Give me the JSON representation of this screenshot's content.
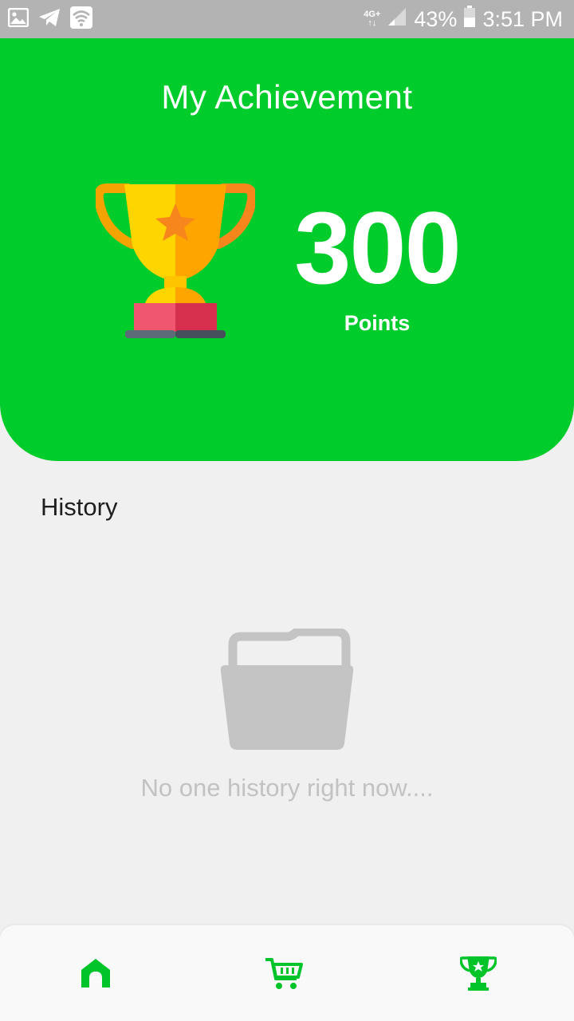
{
  "status_bar": {
    "network_top": "4G+",
    "network_bottom": "↑↓",
    "battery": "43%",
    "time": "3:51 PM",
    "icons": [
      "gallery-icon",
      "telegram-icon",
      "wifi-icon",
      "signal-icon",
      "battery-icon"
    ]
  },
  "header": {
    "title": "My Achievement",
    "points_value": "300",
    "points_label": "Points",
    "icon": "trophy-icon"
  },
  "history": {
    "title": "History",
    "empty_icon": "folder-icon",
    "empty_text": "No one history right now...."
  },
  "bottom_nav": {
    "items": [
      {
        "icon": "home-icon",
        "active": false
      },
      {
        "icon": "cart-icon",
        "active": false
      },
      {
        "icon": "trophy-icon",
        "active": true
      }
    ]
  },
  "colors": {
    "brand_green": "#00cc2c",
    "status_bar": "#b3b3b3",
    "background": "#f0f0f0",
    "muted": "#c2c2c2"
  }
}
